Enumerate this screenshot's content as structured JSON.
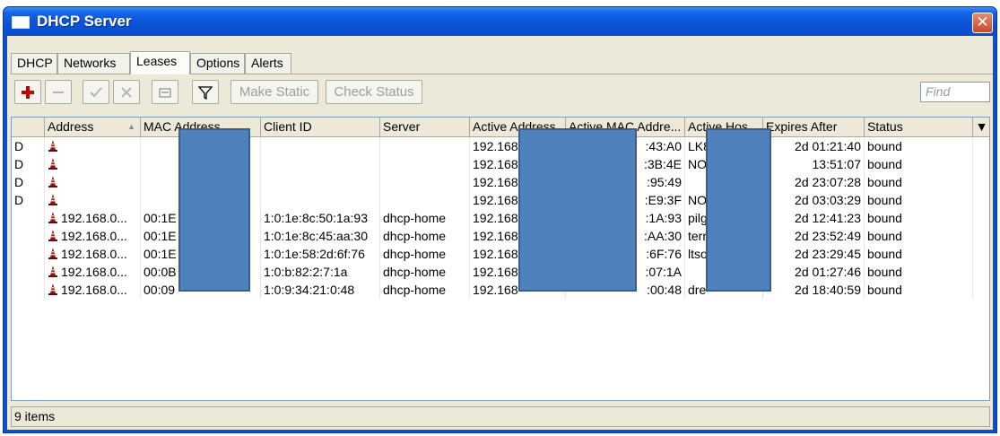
{
  "window": {
    "title": "DHCP Server",
    "close_glyph": "✕"
  },
  "tabs": [
    {
      "label": "DHCP",
      "active": false
    },
    {
      "label": "Networks",
      "active": false
    },
    {
      "label": "Leases",
      "active": true
    },
    {
      "label": "Options",
      "active": false
    },
    {
      "label": "Alerts",
      "active": false
    }
  ],
  "toolbar": {
    "add_icon": "plus-icon",
    "remove_icon": "minus-icon",
    "enable_icon": "check-icon",
    "disable_icon": "x-icon",
    "comment_icon": "note-icon",
    "filter_icon": "filter-icon",
    "make_static": "Make Static",
    "check_status": "Check Status",
    "find_placeholder": "Find"
  },
  "columns": [
    "",
    "Address",
    "MAC Address",
    "Client ID",
    "Server",
    "Active Address",
    "Active MAC Addre...",
    "Active Hos...",
    "Expires After",
    "Status"
  ],
  "rows": [
    {
      "flag": "D",
      "address": "",
      "mac": "",
      "client_id": "",
      "server": "",
      "active_address": "192.168",
      "active_mac": ":43:A0",
      "active_host": "LK8",
      "expires": "2d 01:21:40",
      "status": "bound"
    },
    {
      "flag": "D",
      "address": "",
      "mac": "",
      "client_id": "",
      "server": "",
      "active_address": "192.168",
      "active_mac": ":3B:4E",
      "active_host": "NO",
      "expires": "13:51:07",
      "status": "bound"
    },
    {
      "flag": "D",
      "address": "",
      "mac": "",
      "client_id": "",
      "server": "",
      "active_address": "192.168",
      "active_mac": ":95:49",
      "active_host": "",
      "expires": "2d 23:07:28",
      "status": "bound"
    },
    {
      "flag": "D",
      "address": "",
      "mac": "",
      "client_id": "",
      "server": "",
      "active_address": "192.168",
      "active_mac": ":E9:3F",
      "active_host": "NO",
      "expires": "2d 03:03:29",
      "status": "bound"
    },
    {
      "flag": "",
      "address": "192.168.0...",
      "mac": "00:1E",
      "client_id": "1:0:1e:8c:50:1a:93",
      "server": "dhcp-home",
      "active_address": "192.168",
      "active_mac": ":1A:93",
      "active_host": "pilg",
      "expires": "2d 12:41:23",
      "status": "bound"
    },
    {
      "flag": "",
      "address": "192.168.0...",
      "mac": "00:1E",
      "client_id": "1:0:1e:8c:45:aa:30",
      "server": "dhcp-home",
      "active_address": "192.168",
      "active_mac": ":AA:30",
      "active_host": "term",
      "expires": "2d 23:52:49",
      "status": "bound"
    },
    {
      "flag": "",
      "address": "192.168.0...",
      "mac": "00:1E",
      "client_id": "1:0:1e:58:2d:6f:76",
      "server": "dhcp-home",
      "active_address": "192.168",
      "active_mac": ":6F:76",
      "active_host": "ltso",
      "expires": "2d 23:29:45",
      "status": "bound"
    },
    {
      "flag": "",
      "address": "192.168.0...",
      "mac": "00:0B",
      "client_id": "1:0:b:82:2:7:1a",
      "server": "dhcp-home",
      "active_address": "192.168",
      "active_mac": ":07:1A",
      "active_host": "",
      "expires": "2d 01:27:46",
      "status": "bound"
    },
    {
      "flag": "",
      "address": "192.168.0...",
      "mac": "00:09",
      "client_id": "1:0:9:34:21:0:48",
      "server": "dhcp-home",
      "active_address": "192.168",
      "active_mac": ":00:48",
      "active_host": "dre",
      "expires": "2d 18:40:59",
      "status": "bound"
    }
  ],
  "status_bar": {
    "count_label": "9 items"
  },
  "colors": {
    "title_blue": "#0a52d6",
    "redaction": "#4f81bd",
    "add_red": "#c00000"
  }
}
